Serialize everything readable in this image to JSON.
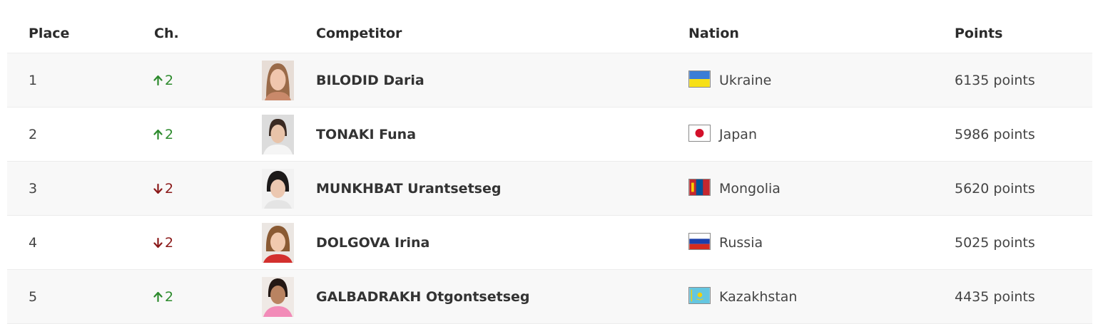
{
  "table": {
    "headers": {
      "place": "Place",
      "change": "Ch.",
      "competitor": "Competitor",
      "nation": "Nation",
      "points": "Points"
    },
    "rows": [
      {
        "place": "1",
        "change_dir": "up",
        "change": "2",
        "competitor": "BILODID Daria",
        "nation": "Ukraine",
        "flag": "ukraine-flag",
        "points": "6135 points",
        "photo": "athlete-photo"
      },
      {
        "place": "2",
        "change_dir": "up",
        "change": "2",
        "competitor": "TONAKI Funa",
        "nation": "Japan",
        "flag": "japan-flag",
        "points": "5986 points",
        "photo": "athlete-photo"
      },
      {
        "place": "3",
        "change_dir": "down",
        "change": "2",
        "competitor": "MUNKHBAT Urantsetseg",
        "nation": "Mongolia",
        "flag": "mongolia-flag",
        "points": "5620 points",
        "photo": "athlete-photo"
      },
      {
        "place": "4",
        "change_dir": "down",
        "change": "2",
        "competitor": "DOLGOVA Irina",
        "nation": "Russia",
        "flag": "russia-flag",
        "points": "5025 points",
        "photo": "athlete-photo"
      },
      {
        "place": "5",
        "change_dir": "up",
        "change": "2",
        "competitor": "GALBADRAKH Otgontsetseg",
        "nation": "Kazakhstan",
        "flag": "kazakhstan-flag",
        "points": "4435 points",
        "photo": "athlete-photo"
      }
    ]
  },
  "colors": {
    "up": "#2e8b2e",
    "down": "#8b1a1a",
    "row_alt": "#f8f8f8"
  }
}
